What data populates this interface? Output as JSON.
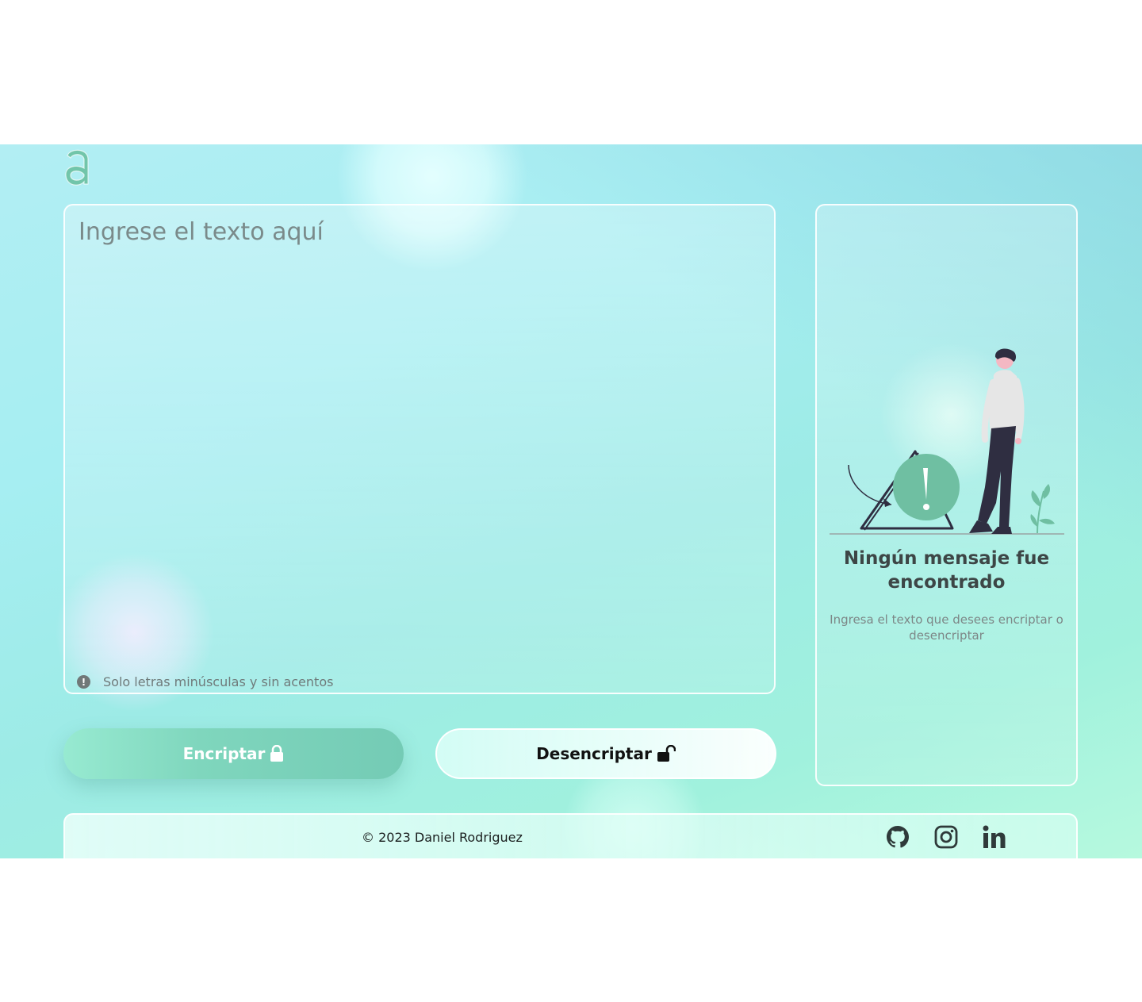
{
  "brand": {
    "logo_letter": "a",
    "color": "#71c5aa"
  },
  "input": {
    "placeholder": "Ingrese el texto aquí",
    "hint": "Solo letras minúsculas y sin acentos",
    "hint_icon": "exclamation-circle-icon"
  },
  "buttons": {
    "encrypt_label": "Encriptar",
    "encrypt_icon": "lock-icon",
    "decrypt_label": "Desencriptar",
    "decrypt_icon": "unlock-icon"
  },
  "output": {
    "title": "Ningún mensaje fue encontrado",
    "description": "Ingresa el texto que desees encriptar o desencriptar",
    "illustration": "person-with-warning-sign"
  },
  "footer": {
    "copyright": "© 2023 Daniel Rodriguez",
    "social": [
      "github-icon",
      "instagram-icon",
      "linkedin-icon"
    ]
  },
  "colors": {
    "accent": "#6fc0a6",
    "text_dark": "#3d4646"
  }
}
